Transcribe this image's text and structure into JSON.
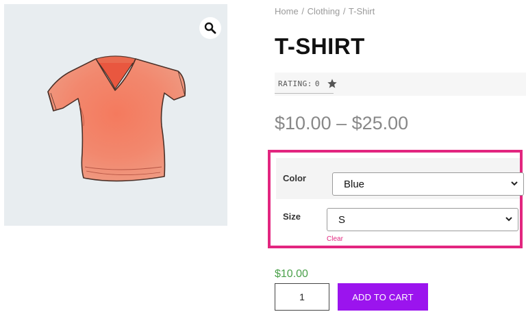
{
  "breadcrumb": {
    "home": "Home",
    "category": "Clothing",
    "current": "T-Shirt",
    "separator": "/"
  },
  "product": {
    "title": "T-SHIRT",
    "rating_label": "RATING:",
    "rating_value": "0",
    "price_range": "$10.00 – $25.00",
    "image_icon": "tshirt-illustration",
    "zoom_icon": "magnifier-icon"
  },
  "variations": {
    "color": {
      "label": "Color",
      "selected": "Blue"
    },
    "size": {
      "label": "Size",
      "selected": "S"
    },
    "clear_label": "Clear",
    "highlight_color": "#e2267f"
  },
  "purchase": {
    "variation_price": "$10.00",
    "quantity": "1",
    "add_to_cart_label": "ADD TO CART",
    "button_color": "#9b14ee",
    "price_color": "#4aa04a"
  }
}
